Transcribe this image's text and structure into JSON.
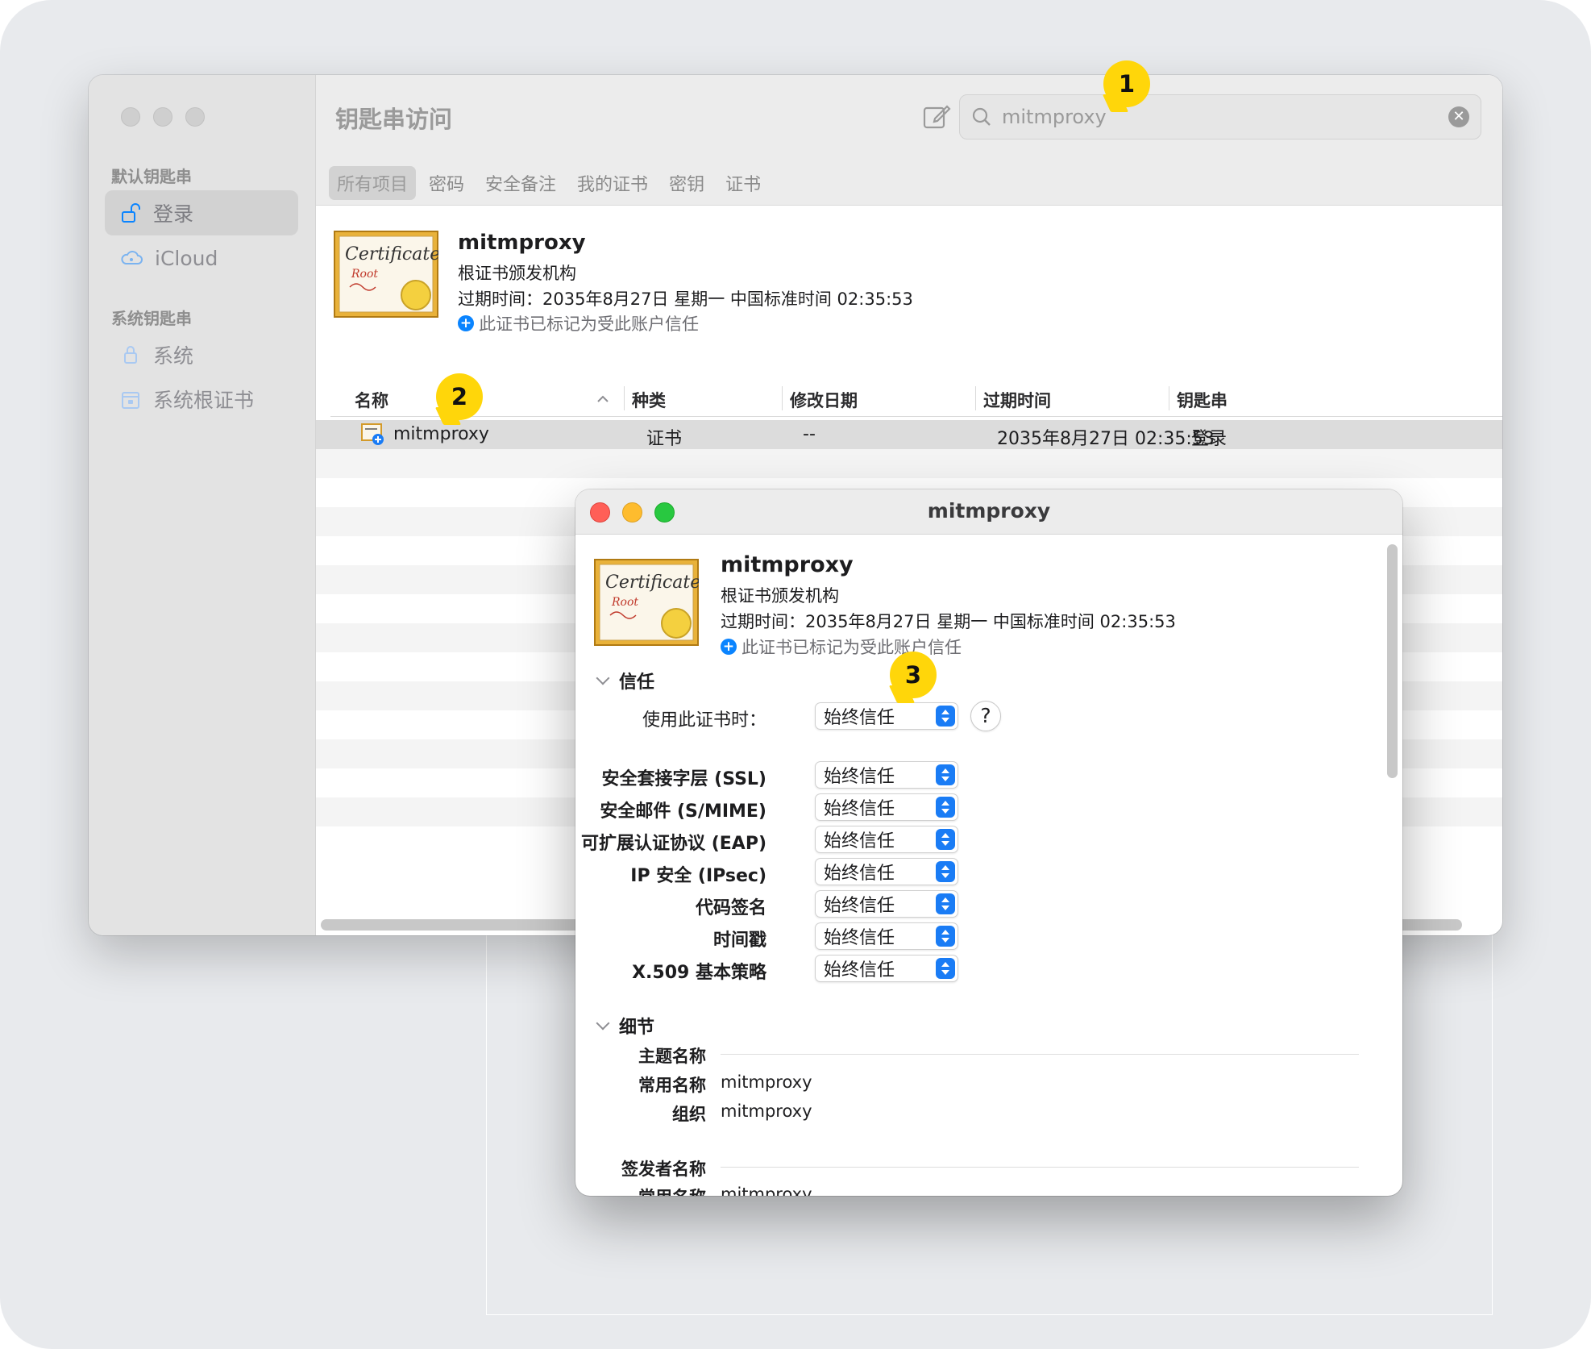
{
  "window": {
    "title": "钥匙串访问",
    "sidebar": {
      "section1": "默认钥匙串",
      "items1": [
        {
          "label": "登录"
        },
        {
          "label": "iCloud"
        }
      ],
      "section2": "系统钥匙串",
      "items2": [
        {
          "label": "系统"
        },
        {
          "label": "系统根证书"
        }
      ]
    },
    "toolbar": {
      "compose_icon": "square-and-pencil-icon",
      "info_icon": "info-circle-icon"
    },
    "search": {
      "value": "mitmproxy",
      "icon": "magnifyingglass-icon",
      "clear_icon": "xmark-circle-icon"
    },
    "tabs": [
      "所有项目",
      "密码",
      "安全备注",
      "我的证书",
      "密钥",
      "证书"
    ],
    "selected_tab": "所有项目",
    "cert": {
      "name": "mitmproxy",
      "type": "根证书颁发机构",
      "expiry": "过期时间：2035年8月27日 星期一 中国标准时间 02:35:53",
      "trust": "此证书已标记为受此账户信任"
    },
    "table": {
      "columns": [
        "名称",
        "种类",
        "修改日期",
        "过期时间",
        "钥匙串"
      ],
      "rows": [
        {
          "name": "mitmproxy",
          "kind": "证书",
          "modified": "--",
          "expires": "2035年8月27日 02:35:53",
          "keychain": "登录"
        }
      ]
    }
  },
  "panel": {
    "title": "mitmproxy",
    "cert": {
      "name": "mitmproxy",
      "type": "根证书颁发机构",
      "expiry": "过期时间：2035年8月27日 星期一 中国标准时间 02:35:53",
      "trust": "此证书已标记为受此账户信任"
    },
    "trust_section": "信任",
    "use_label": "使用此证书时：",
    "use_value": "始终信任",
    "help": "?",
    "policies": [
      {
        "label": "安全套接字层 (SSL)",
        "value": "始终信任"
      },
      {
        "label": "安全邮件 (S/MIME)",
        "value": "始终信任"
      },
      {
        "label": "可扩展认证协议 (EAP)",
        "value": "始终信任"
      },
      {
        "label": "IP 安全 (IPsec)",
        "value": "始终信任"
      },
      {
        "label": "代码签名",
        "value": "始终信任"
      },
      {
        "label": "时间戳",
        "value": "始终信任"
      },
      {
        "label": "X.509 基本策略",
        "value": "始终信任"
      }
    ],
    "details_section": "细节",
    "subject_name": "主题名称",
    "subject_cn_label": "常用名称",
    "subject_cn": "mitmproxy",
    "subject_org_label": "组织",
    "subject_org": "mitmproxy",
    "issuer_name": "签发者名称",
    "issuer_cn_label": "常用名称",
    "issuer_cn": "mitmproxy"
  },
  "callouts": [
    "1",
    "2",
    "3"
  ],
  "colors": {
    "accent": "#0a84ff",
    "callout": "#ffd60a",
    "close": "#ff5f57",
    "minimize": "#febc2e",
    "zoom": "#28c840"
  }
}
